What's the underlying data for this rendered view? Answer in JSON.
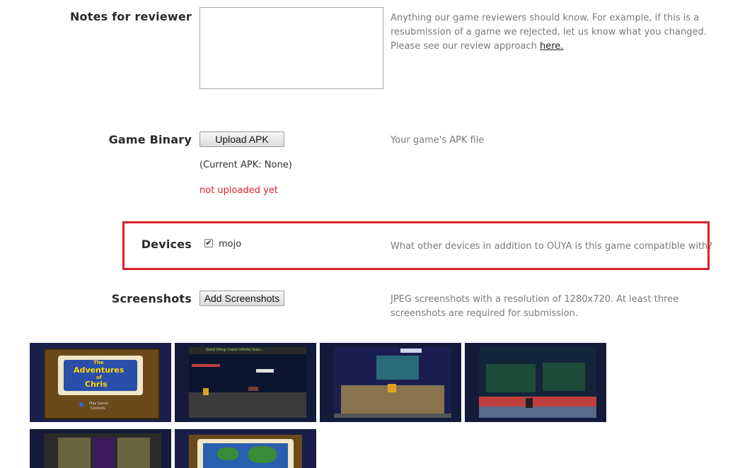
{
  "notes": {
    "label": "Notes for reviewer",
    "help": "Anything our game reviewers should know. For example, if this is a resubmission of a game we rejected, let us know what you changed. Please see our review approach ",
    "help_link": "here."
  },
  "binary": {
    "label": "Game Binary",
    "button": "Upload APK",
    "current": "(Current APK: None)",
    "status": "not uploaded yet",
    "help": "Your game's APK file"
  },
  "devices": {
    "label": "Devices",
    "option": "mojo",
    "checked": true,
    "help": "What other devices in addition to OUYA is this game compatible with?"
  },
  "screenshots": {
    "label": "Screenshots",
    "button": "Add Screenshots",
    "help": "JPEG screenshots with a resolution of 1280x720. At least three screenshots are required for submission.",
    "thumb1": {
      "title_line1": "The",
      "title_line2": "Adventures",
      "title_line3": "of",
      "title_line4": "Chris",
      "menu": "Play Game",
      "menu2": "Controls"
    },
    "thumb2": {
      "caption": "Good thing I have infinite lives..."
    }
  },
  "colors": {
    "status_red": "#e0202b",
    "highlight": "#e0202b"
  }
}
